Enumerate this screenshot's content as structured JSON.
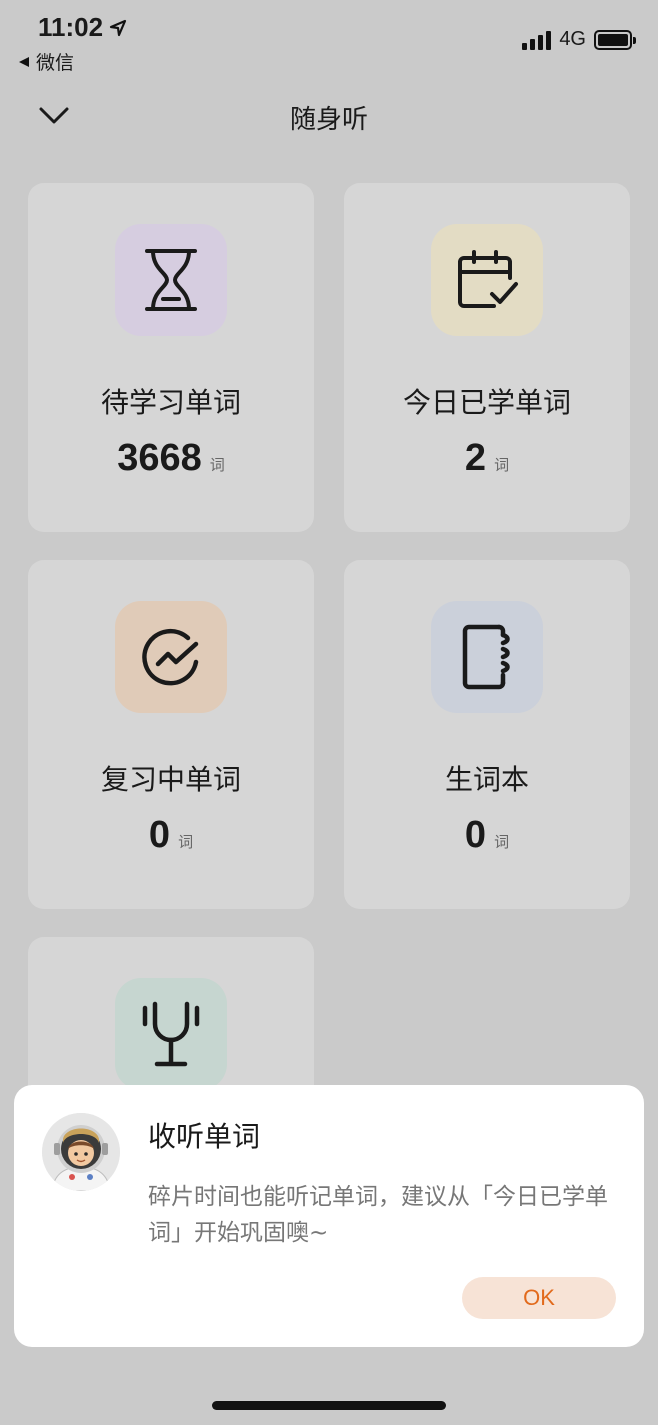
{
  "status_bar": {
    "time": "11:02",
    "back_app": "微信",
    "network": "4G"
  },
  "header": {
    "title": "随身听"
  },
  "cards": [
    {
      "label": "待学习单词",
      "count": "3668",
      "unit": "词",
      "icon": "hourglass-icon",
      "icon_bg": "#d6cde0"
    },
    {
      "label": "今日已学单词",
      "count": "2",
      "unit": "词",
      "icon": "calendar-check-icon",
      "icon_bg": "#e3dcc4"
    },
    {
      "label": "复习中单词",
      "count": "0",
      "unit": "词",
      "icon": "progress-trend-icon",
      "icon_bg": "#e0cbb8"
    },
    {
      "label": "生词本",
      "count": "0",
      "unit": "词",
      "icon": "notebook-icon",
      "icon_bg": "#cbd0da"
    },
    {
      "label": "",
      "count": "",
      "unit": "",
      "icon": "trophy-icon",
      "icon_bg": "#c6d6d0"
    }
  ],
  "dialog": {
    "title": "收听单词",
    "message": "碎片时间也能听记单词，建议从「今日已学单词」开始巩固噢~",
    "ok_label": "OK",
    "avatar": "astronaut-avatar"
  }
}
